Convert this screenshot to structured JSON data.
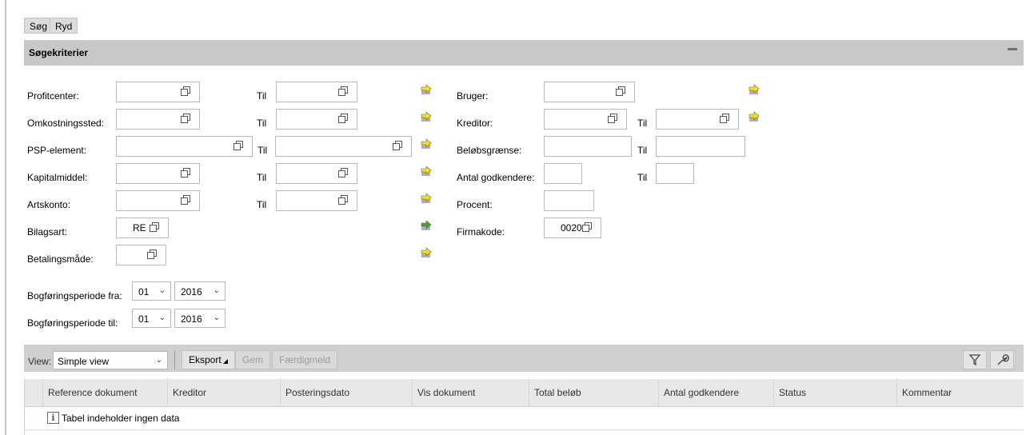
{
  "top_buttons": {
    "search": "Søg",
    "clear": "Ryd"
  },
  "panel": {
    "title": "Søgekriterier"
  },
  "left_fields": [
    {
      "label": "Profitcenter:",
      "to_label": "Til"
    },
    {
      "label": "Omkostningssted:",
      "to_label": "Til"
    },
    {
      "label": "PSP-element:",
      "to_label": "Til"
    },
    {
      "label": "Kapitalmiddel:",
      "to_label": "Til"
    },
    {
      "label": "Artskonto:",
      "to_label": "Til"
    },
    {
      "label": "Bilagsart:",
      "value": "RE"
    },
    {
      "label": "Betalingsmåde:"
    }
  ],
  "right_fields": [
    {
      "label": "Bruger:"
    },
    {
      "label": "Kreditor:",
      "to_label": "Til"
    },
    {
      "label": "Beløbsgrænse:",
      "to_label": "Til"
    },
    {
      "label": "Antal godkendere:",
      "to_label": "Til"
    },
    {
      "label": "Procent:"
    },
    {
      "label": "Firmakode:",
      "value": "0020"
    }
  ],
  "period": {
    "from_label": "Bogføringsperiode fra:",
    "to_label": "Bogføringsperiode til:",
    "from_month": "01",
    "from_year": "2016",
    "to_month": "01",
    "to_year": "2016"
  },
  "toolbar": {
    "view_label": "View:",
    "view_value": "Simple view",
    "export": "Eksport",
    "save": "Gem",
    "finish": "Færdigmeld"
  },
  "table": {
    "columns": [
      "Reference dokument",
      "Kreditor",
      "Posteringsdato",
      "Vis dokument",
      "Total beløb",
      "Antal godkendere",
      "Status",
      "Kommentar"
    ],
    "empty_message": "Tabel indeholder ingen data"
  },
  "colors": {
    "arrow_yellow": "#f6e21a",
    "arrow_green": "#3aa43a",
    "header_bg": "#c8c8c8"
  }
}
